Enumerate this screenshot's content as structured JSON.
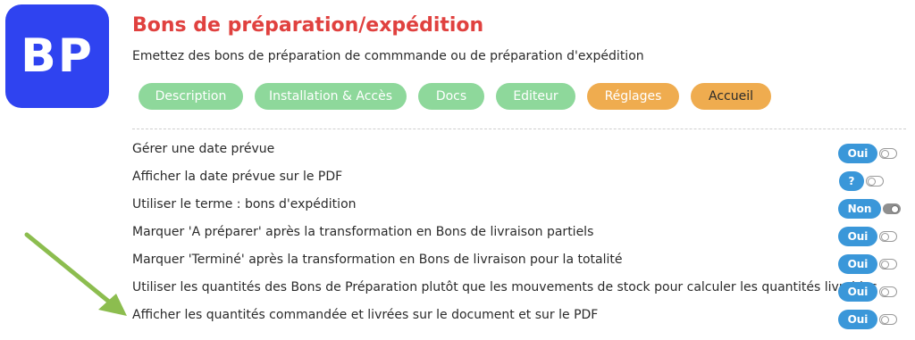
{
  "app": {
    "logo_text": "BP",
    "title": "Bons de préparation/expédition",
    "subtitle": "Emettez des bons de préparation de commmande ou de préparation d'expédition"
  },
  "nav": {
    "description": "Description",
    "installation": "Installation & Accès",
    "docs": "Docs",
    "editeur": "Editeur",
    "reglages": "Réglages",
    "accueil": "Accueil"
  },
  "settings": [
    {
      "label": "Gérer une date prévue",
      "value": "Oui",
      "toggle": "off"
    },
    {
      "label": "Afficher la date prévue sur le PDF",
      "value": "?",
      "toggle": "off"
    },
    {
      "label": "Utiliser le terme : bons d'expédition",
      "value": "Non",
      "toggle": "on"
    },
    {
      "label": "Marquer 'A préparer' après la transformation en Bons de livraison partiels",
      "value": "Oui",
      "toggle": "off"
    },
    {
      "label": "Marquer 'Terminé' après la transformation en Bons de livraison pour la totalité",
      "value": "Oui",
      "toggle": "off"
    },
    {
      "label": "Utiliser les quantités des Bons de Préparation plutôt que les mouvements de stock pour calculer les quantités livrables",
      "value": "Oui",
      "toggle": "off"
    },
    {
      "label": "Afficher les quantités commandée et livrées sur le document et sur le PDF",
      "value": "Oui",
      "toggle": "off"
    }
  ],
  "colors": {
    "title": "#e0413f",
    "logo_bg": "#2f43f0",
    "pill_green": "#8ed89b",
    "pill_orange": "#efac4f",
    "badge_blue": "#3a97d9",
    "arrow_green": "#8cbd4f"
  },
  "icons": {
    "arrow": "arrow-pointing-icon",
    "toggle": "toggle-switch-icon"
  }
}
